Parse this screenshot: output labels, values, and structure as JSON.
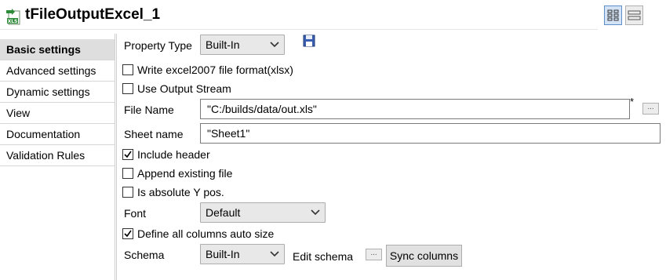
{
  "component": {
    "title": "tFileOutputExcel_1",
    "icon": "excel-file-output-icon",
    "icon_label": "XLS",
    "accent": "#2e8b3a"
  },
  "view_buttons": {
    "grid": "grid-view-icon",
    "list": "list-view-icon"
  },
  "sidebar": {
    "items": [
      {
        "label": "Basic settings",
        "selected": true
      },
      {
        "label": "Advanced settings"
      },
      {
        "label": "Dynamic settings"
      },
      {
        "label": "View"
      },
      {
        "label": "Documentation"
      },
      {
        "label": "Validation Rules"
      }
    ]
  },
  "form": {
    "property_type": {
      "label": "Property Type",
      "value": "Built-In",
      "save_icon": "save-disk-icon"
    },
    "write_xlsx": {
      "label": "Write excel2007 file format(xlsx)",
      "checked": false
    },
    "use_output_stream": {
      "label": "Use Output Stream",
      "checked": false
    },
    "file_name": {
      "label": "File Name",
      "value": "\"C:/builds/data/out.xls\"",
      "marker": "*",
      "browse": "..."
    },
    "sheet_name": {
      "label": "Sheet name",
      "value": "\"Sheet1\""
    },
    "include_header": {
      "label": "Include header",
      "checked": true
    },
    "append_existing": {
      "label": "Append existing file",
      "checked": false
    },
    "absolute_y": {
      "label": "Is absolute Y pos.",
      "checked": false
    },
    "font": {
      "label": "Font",
      "value": "Default"
    },
    "auto_size": {
      "label": "Define all columns auto size",
      "checked": true
    },
    "schema": {
      "label": "Schema",
      "value": "Built-In",
      "edit_label": "Edit schema",
      "edit_button": "...",
      "sync_label": "Sync columns"
    }
  }
}
